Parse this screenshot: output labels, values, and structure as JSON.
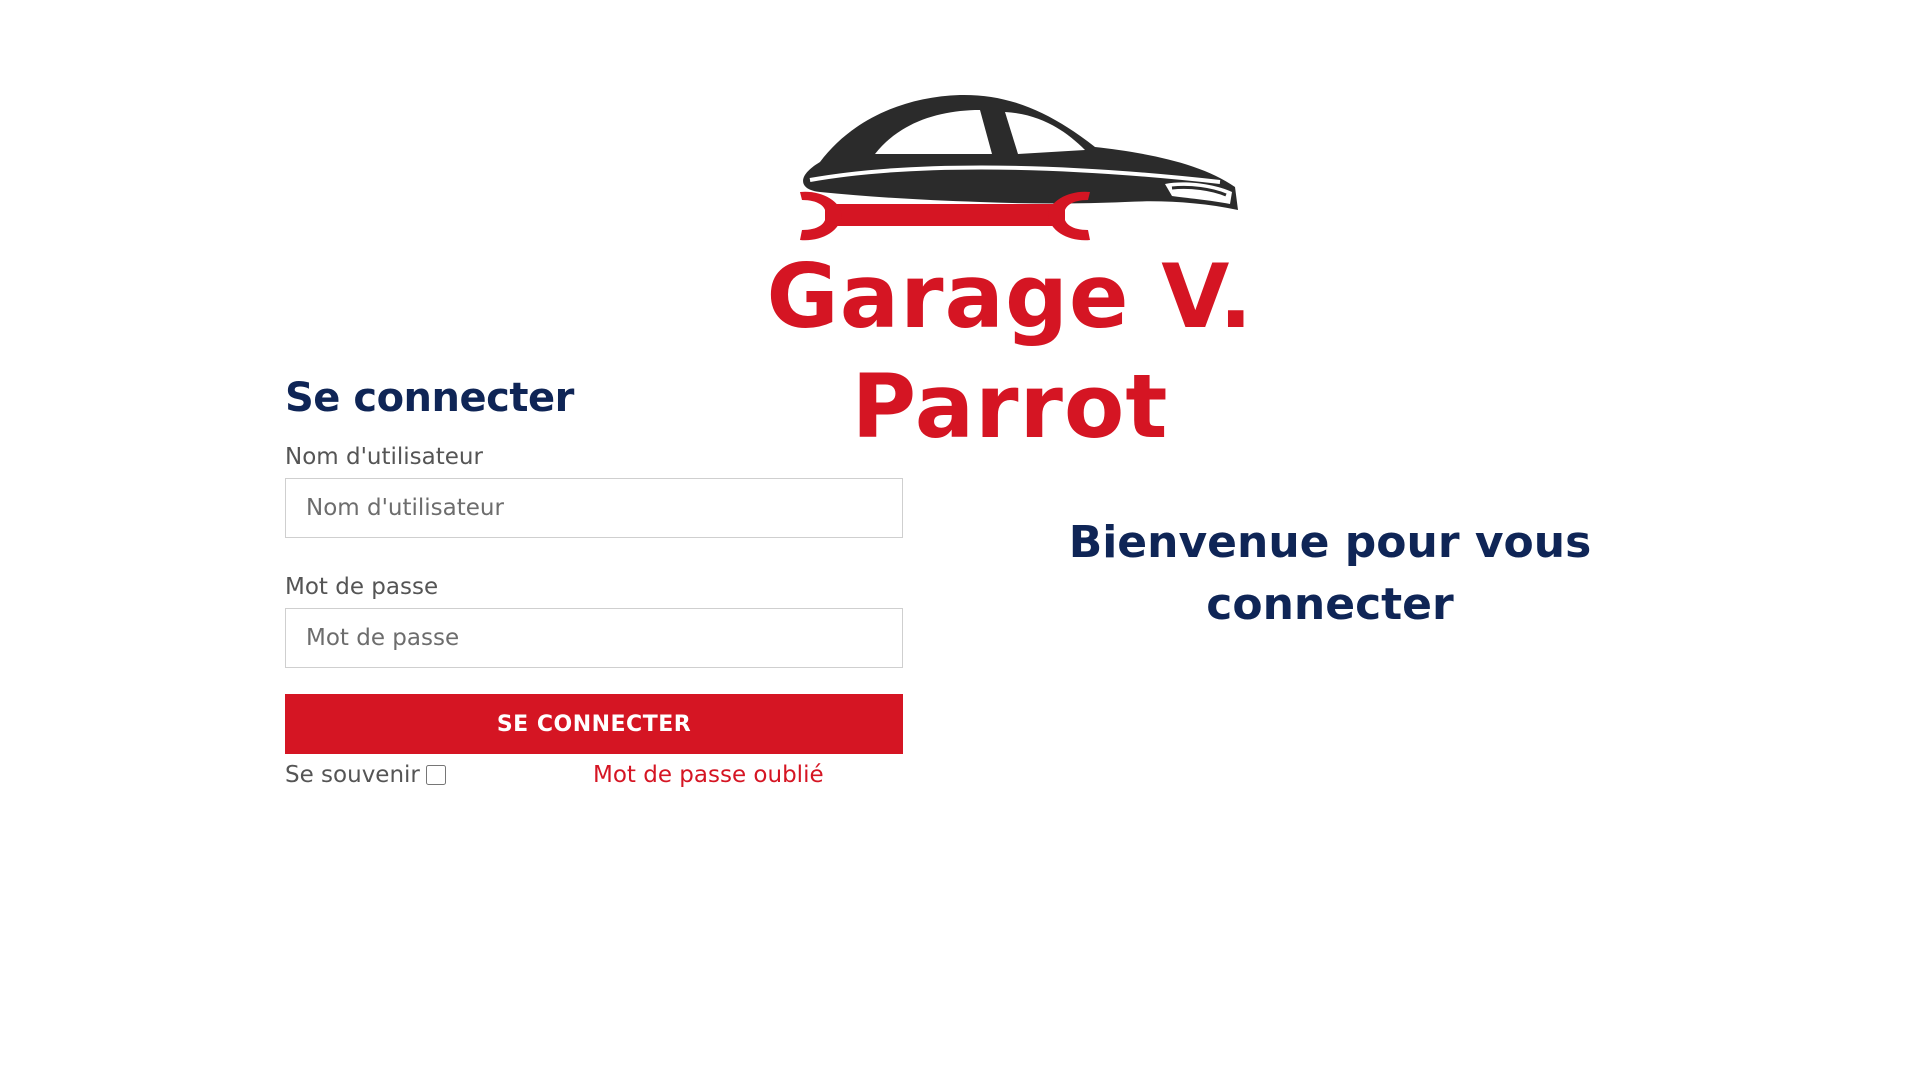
{
  "colors": {
    "brand_red": "#d51523",
    "navy": "#0f2556",
    "label_gray": "#555555",
    "car_dark": "#2b2b2b"
  },
  "logo": {
    "brand_name": "Garage V. Parrot",
    "icon": "car-wrench-icon"
  },
  "login": {
    "title": "Se connecter",
    "username_label": "Nom d'utilisateur",
    "username_placeholder": "Nom d'utilisateur",
    "username_value": "",
    "password_label": "Mot de passe",
    "password_placeholder": "Mot de passe",
    "password_value": "",
    "submit_label": "SE CONNECTER",
    "remember_label": "Se souvenir",
    "remember_checked": false,
    "forgot_label": "Mot de passe oublié"
  },
  "welcome": {
    "line1": "Bienvenue pour vous",
    "line2": "connecter"
  }
}
